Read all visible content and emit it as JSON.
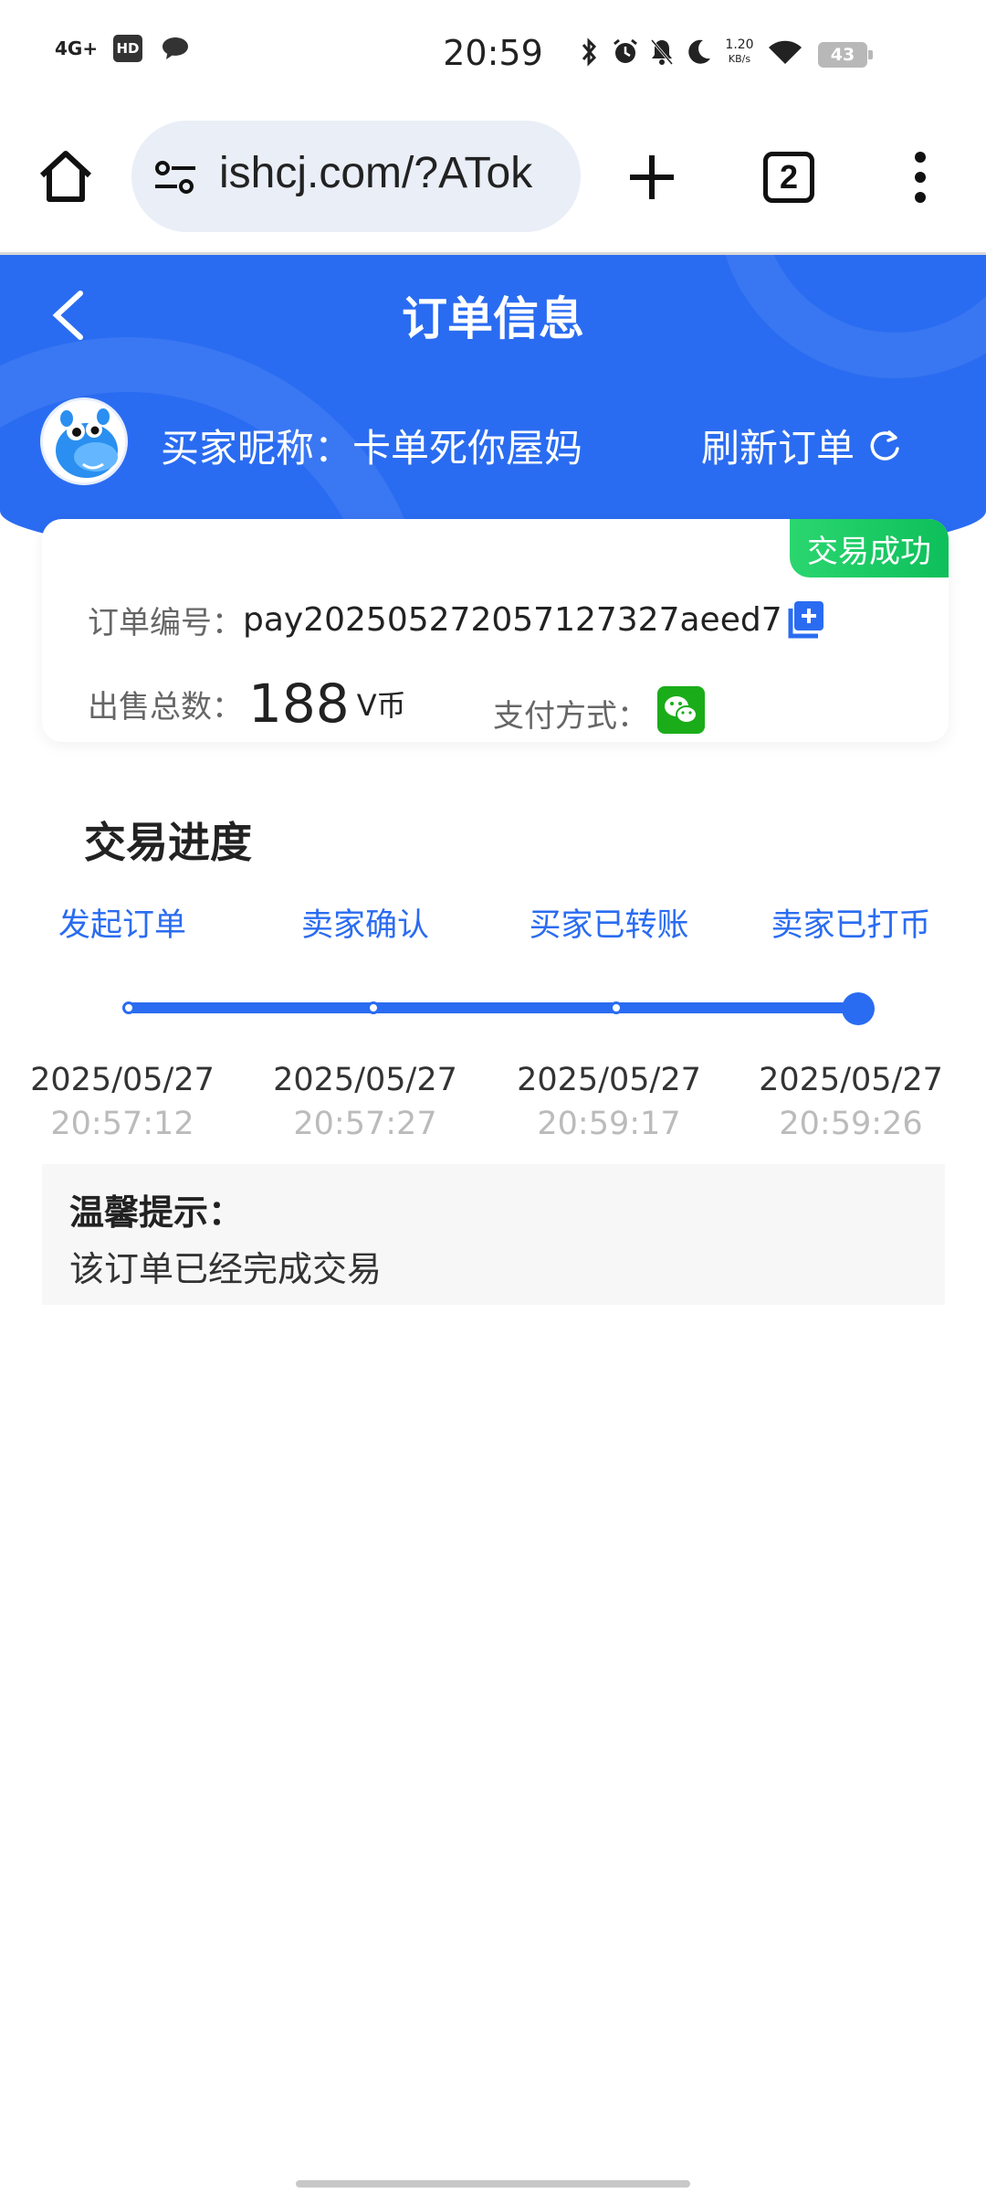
{
  "status_bar": {
    "network": "4G+",
    "hd": "HD",
    "time": "20:59",
    "speed_value": "1.20",
    "speed_unit": "KB/s",
    "battery": "43"
  },
  "browser": {
    "url": "ishcj.com/?ATok",
    "tab_count": "2"
  },
  "header": {
    "title": "订单信息",
    "buyer_label": "买家昵称：卡单死你屋妈",
    "refresh_label": "刷新订单"
  },
  "order": {
    "status": "交易成功",
    "order_no_label": "订单编号：",
    "order_no": "pay2025052720571273​27aeed7",
    "count_label": "出售总数：",
    "count_value": "188",
    "count_unit": "V币",
    "pay_method_label": "支付方式："
  },
  "progress": {
    "title": "交易进度",
    "steps": [
      {
        "label": "发起订单",
        "date": "2025/05/27",
        "time": "20:57:12"
      },
      {
        "label": "卖家确认",
        "date": "2025/05/27",
        "time": "20:57:27"
      },
      {
        "label": "买家已转账",
        "date": "2025/05/27",
        "time": "20:59:17"
      },
      {
        "label": "卖家已打币",
        "date": "2025/05/27",
        "time": "20:59:26"
      }
    ]
  },
  "tip": {
    "title": "温馨提示：",
    "text": "该订单已经完成交易"
  },
  "colors": {
    "primary": "#2a6cf1",
    "success": "#14c463",
    "wechat": "#1aad19"
  }
}
